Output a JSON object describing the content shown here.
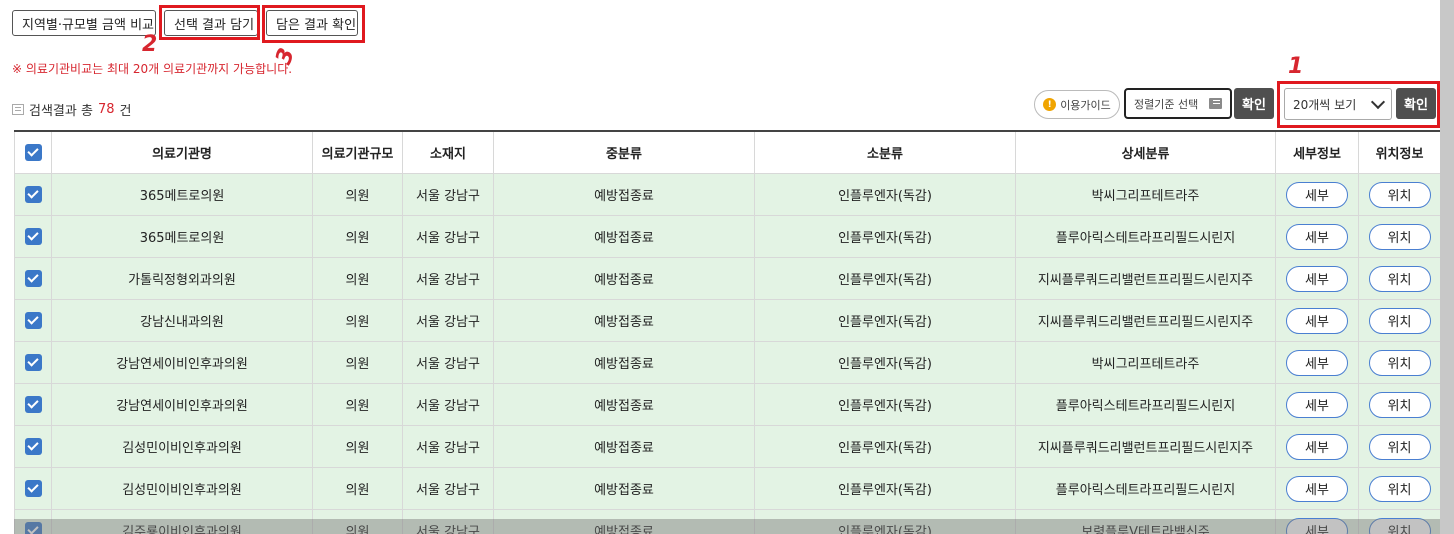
{
  "toolbar": {
    "compare_label": "지역별·규모별 금액 비교",
    "add_label": "선택 결과 담기",
    "view_label": "담은 결과 확인"
  },
  "notice": "※ 의료기관비교는 최대 20개 의료기관까지 가능합니다.",
  "annotations": {
    "a1": "1",
    "a2": "2",
    "a3": "3"
  },
  "summary": {
    "prefix": "검색결과 총 ",
    "count": "78",
    "suffix": "건"
  },
  "controls": {
    "guide_label": "이용가이드",
    "sort_label": "정렬기준 선택",
    "confirm_label": "확인",
    "per_page_value": "20개씩 보기",
    "confirm2_label": "확인"
  },
  "table": {
    "headers": [
      "의료기관명",
      "의료기관규모",
      "소재지",
      "중분류",
      "소분류",
      "상세분류",
      "세부정보",
      "위치정보"
    ],
    "detail_label": "세부",
    "location_label": "위치",
    "rows": [
      [
        "365메트로의원",
        "의원",
        "서울 강남구",
        "예방접종료",
        "인플루엔자(독감)",
        "박씨그리프테트라주"
      ],
      [
        "365메트로의원",
        "의원",
        "서울 강남구",
        "예방접종료",
        "인플루엔자(독감)",
        "플루아릭스테트라프리필드시린지"
      ],
      [
        "가톨릭정형외과의원",
        "의원",
        "서울 강남구",
        "예방접종료",
        "인플루엔자(독감)",
        "지씨플루쿼드리밸런트프리필드시린지주"
      ],
      [
        "강남신내과의원",
        "의원",
        "서울 강남구",
        "예방접종료",
        "인플루엔자(독감)",
        "지씨플루쿼드리밸런트프리필드시린지주"
      ],
      [
        "강남연세이비인후과의원",
        "의원",
        "서울 강남구",
        "예방접종료",
        "인플루엔자(독감)",
        "박씨그리프테트라주"
      ],
      [
        "강남연세이비인후과의원",
        "의원",
        "서울 강남구",
        "예방접종료",
        "인플루엔자(독감)",
        "플루아릭스테트라프리필드시린지"
      ],
      [
        "김성민이비인후과의원",
        "의원",
        "서울 강남구",
        "예방접종료",
        "인플루엔자(독감)",
        "지씨플루쿼드리밸런트프리필드시린지주"
      ],
      [
        "김성민이비인후과의원",
        "의원",
        "서울 강남구",
        "예방접종료",
        "인플루엔자(독감)",
        "플루아릭스테트라프리필드시린지"
      ],
      [
        "김주룡이비인후과의원",
        "의원",
        "서울 강남구",
        "예방접종료",
        "인플루엔자(독감)",
        "보령플루Ⅴ테트라백신주"
      ]
    ]
  },
  "colors": {
    "highlight": "#e0191f",
    "row_bg": "#e3f3e4",
    "checkbox": "#3b78c8",
    "count": "#d7262f"
  }
}
